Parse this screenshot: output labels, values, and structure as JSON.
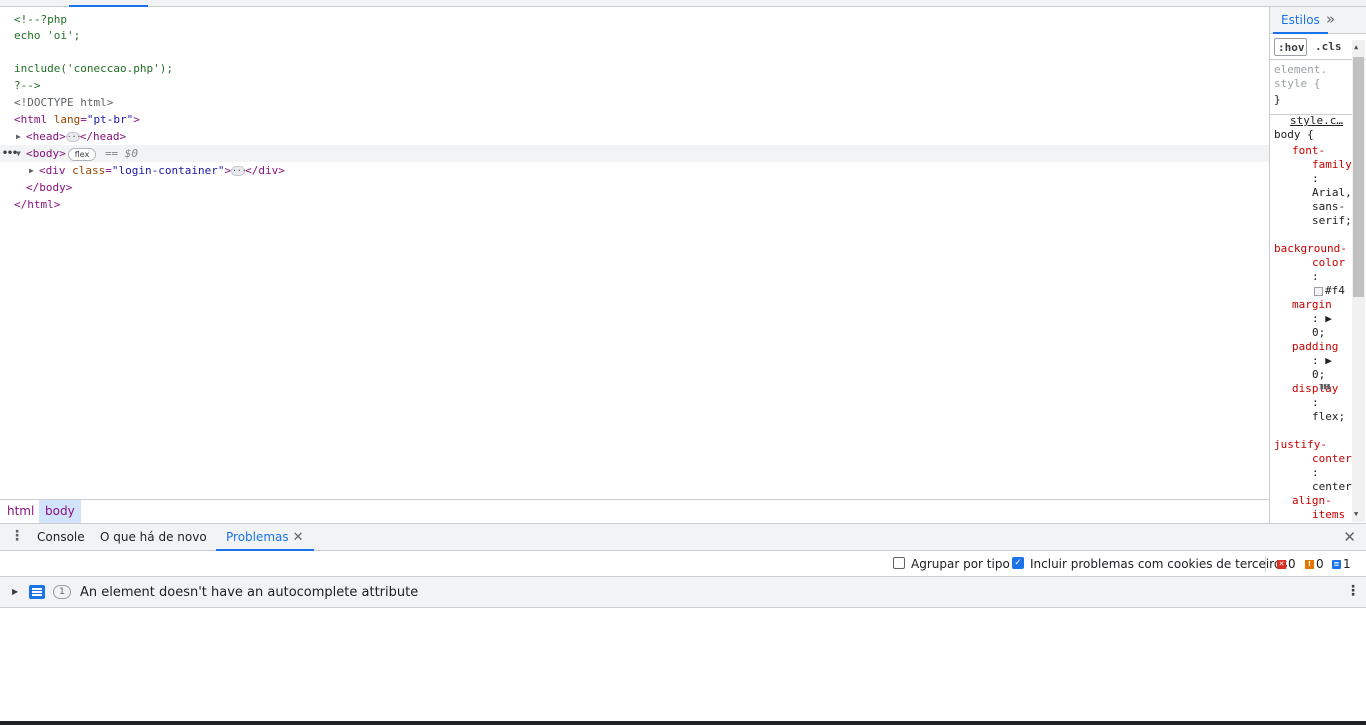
{
  "elements": {
    "lines": {
      "php_open": "<!--?php",
      "echo": "echo 'oi';",
      "include": "include('coneccao.php');",
      "php_close": "?-->",
      "doctype": "<!DOCTYPE html>",
      "html_open_tag": "<html",
      "html_lang_attr": "lang",
      "html_lang_val": "\"pt-br\"",
      "html_open_end": ">",
      "head_open": "<head>",
      "head_close": "</head>",
      "body_open": "<body>",
      "flex_badge": "flex",
      "eq_ref": "== $0",
      "div_open_tag": "<div",
      "div_class_attr": "class",
      "div_class_val": "\"login-container\"",
      "div_open_end": ">",
      "div_close": "</div>",
      "body_close": "</body>",
      "html_close": "</html>"
    }
  },
  "breadcrumb": {
    "items": [
      "html",
      "body"
    ]
  },
  "styles": {
    "tab_label": "Estilos",
    "more_tabs": "»",
    "hov": ":hov",
    "cls": ".cls",
    "element_style_1": "element.",
    "element_style_2": "style {",
    "close_brace": "}",
    "source": "style.c…",
    "selector": "body {",
    "props": {
      "font_family_1": "font-",
      "font_family_2": "family",
      "font_family_colon": ":",
      "font_family_val_1": "Arial,",
      "font_family_val_2": "sans-",
      "font_family_val_3": "serif;",
      "bg_1": "background-",
      "bg_2": "color",
      "bg_colon": ":",
      "bg_val": "#f4",
      "margin": "margin",
      "margin_colon": ": ▶",
      "margin_val": "0;",
      "padding": "padding",
      "padding_colon": ": ▶",
      "padding_val": "0;",
      "display": "display",
      "display_colon": ":",
      "display_val": "flex;",
      "justify_1": "justify-",
      "justify_2": "conter",
      "justify_colon": ":",
      "justify_val": "center",
      "align_1": "align-",
      "align_2": "items"
    }
  },
  "drawer": {
    "tabs": [
      "Console",
      "O que há de novo",
      "Problemas"
    ],
    "active_tab": "Problemas",
    "toolbar": {
      "group_by_type": "Agrupar por tipo",
      "include_third_party": "Incluir problemas com cookies de terceiros",
      "error_count": "0",
      "warning_count": "0",
      "info_count": "1"
    },
    "issue": {
      "count": "1",
      "text": "An element doesn't have an autocomplete attribute"
    }
  },
  "colors": {
    "accent": "#1a73e8",
    "tag": "#881280",
    "attr": "#994500",
    "value": "#1a1aa6",
    "comment": "#236e25",
    "css_prop": "#c80000"
  }
}
